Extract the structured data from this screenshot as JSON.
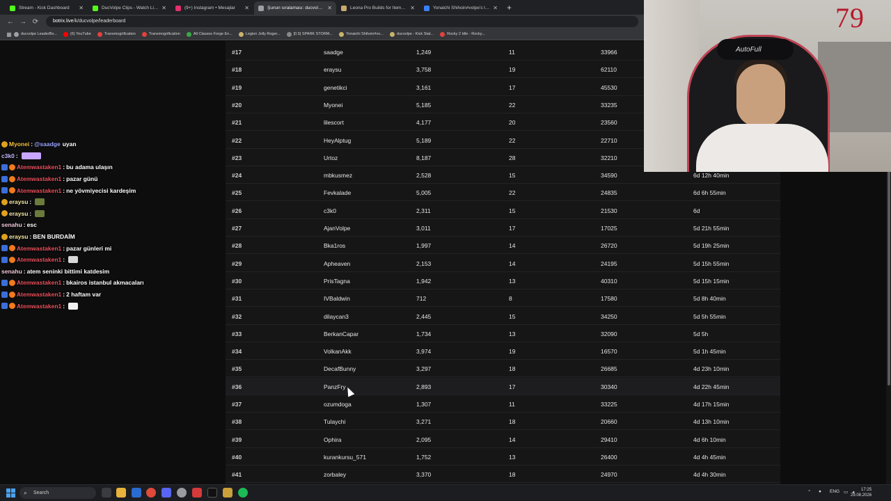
{
  "browser": {
    "tabs": [
      {
        "label": "Stream - Kick Dashboard",
        "color": "#53fc18",
        "active": false
      },
      {
        "label": "DucVolpe Clips - Watch Live on Kick",
        "color": "#53fc18",
        "active": false
      },
      {
        "label": "(9+) Instagram • Mesajlar",
        "color": "#e1306c",
        "active": false
      },
      {
        "label": "Şunun sıralaması: ducvolpe | Yo",
        "color": "#9aa0a6",
        "active": true
      },
      {
        "label": "Leona Pro Builds for Items, Run",
        "color": "#c8aa6e",
        "active": false
      },
      {
        "label": "Yonaichi Shihoin#volpe's live ga",
        "color": "#3b82f6",
        "active": false
      }
    ],
    "new_tab": "+",
    "url_host": "botrix.live",
    "url_path": "/k/ducvolpe/leaderboard",
    "bookmarks": [
      {
        "label": "ducvolpe LeaderBo...",
        "color": "#9aa0a6"
      },
      {
        "label": "(6) YouTube",
        "color": "#ff0000"
      },
      {
        "label": "Transmogrification",
        "color": "#e0433c"
      },
      {
        "label": "Transmogrification",
        "color": "#e0433c"
      },
      {
        "label": "All Classes Forge En...",
        "color": "#39a845"
      },
      {
        "label": "Legion Jolly Roger...",
        "color": "#c8b36a"
      },
      {
        "label": "[0.5] SPARK STORM...",
        "color": "#888888"
      },
      {
        "label": "Yonaichi Shihoin#vo...",
        "color": "#c8b36a"
      },
      {
        "label": "ducvolpe - Kick Stat...",
        "color": "#c8b36a"
      },
      {
        "label": "Rocky 2 Idle - Rocky...",
        "color": "#e0433c"
      }
    ]
  },
  "leaderboard": {
    "rows": [
      {
        "rank": "#17",
        "name": "saadge",
        "v1": "1,249",
        "v2": "11",
        "v3": "33966",
        "time": ""
      },
      {
        "rank": "#18",
        "name": "eraysu",
        "v1": "3,758",
        "v2": "19",
        "v3": "62110",
        "time": ""
      },
      {
        "rank": "#19",
        "name": "genetikci",
        "v1": "3,161",
        "v2": "17",
        "v3": "45530",
        "time": ""
      },
      {
        "rank": "#20",
        "name": "Myonei",
        "v1": "5,185",
        "v2": "22",
        "v3": "33235",
        "time": ""
      },
      {
        "rank": "#21",
        "name": "lilescort",
        "v1": "4,177",
        "v2": "20",
        "v3": "23560",
        "time": ""
      },
      {
        "rank": "#22",
        "name": "HeyAlptug",
        "v1": "5,189",
        "v2": "22",
        "v3": "22710",
        "time": ""
      },
      {
        "rank": "#23",
        "name": "Urtoz",
        "v1": "8,187",
        "v2": "28",
        "v3": "32210",
        "time": ""
      },
      {
        "rank": "#24",
        "name": "mbkusmez",
        "v1": "2,528",
        "v2": "15",
        "v3": "34590",
        "time": "6d 12h 40min"
      },
      {
        "rank": "#25",
        "name": "Fevkalade",
        "v1": "5,005",
        "v2": "22",
        "v3": "24835",
        "time": "6d 6h 55min"
      },
      {
        "rank": "#26",
        "name": "c3k0",
        "v1": "2,311",
        "v2": "15",
        "v3": "21530",
        "time": "6d"
      },
      {
        "rank": "#27",
        "name": "AjanVolpe",
        "v1": "3,011",
        "v2": "17",
        "v3": "17025",
        "time": "5d 21h 55min"
      },
      {
        "rank": "#28",
        "name": "Bka1ros",
        "v1": "1,997",
        "v2": "14",
        "v3": "26720",
        "time": "5d 19h 25min"
      },
      {
        "rank": "#29",
        "name": "Apheaven",
        "v1": "2,153",
        "v2": "14",
        "v3": "24195",
        "time": "5d 15h 55min"
      },
      {
        "rank": "#30",
        "name": "PrisTagna",
        "v1": "1,942",
        "v2": "13",
        "v3": "40310",
        "time": "5d 15h 15min"
      },
      {
        "rank": "#31",
        "name": "IVBaldwin",
        "v1": "712",
        "v2": "8",
        "v3": "17580",
        "time": "5d 8h 40min"
      },
      {
        "rank": "#32",
        "name": "dilaycan3",
        "v1": "2,445",
        "v2": "15",
        "v3": "34250",
        "time": "5d 5h 55min"
      },
      {
        "rank": "#33",
        "name": "BerkanCapar",
        "v1": "1,734",
        "v2": "13",
        "v3": "32090",
        "time": "5d 5h"
      },
      {
        "rank": "#34",
        "name": "VolkanAkk",
        "v1": "3,974",
        "v2": "19",
        "v3": "16570",
        "time": "5d 1h 45min"
      },
      {
        "rank": "#35",
        "name": "DecafBunny",
        "v1": "3,297",
        "v2": "18",
        "v3": "26685",
        "time": "4d 23h 10min"
      },
      {
        "rank": "#36",
        "name": "PanzFry",
        "v1": "2,893",
        "v2": "17",
        "v3": "30340",
        "time": "4d 22h 45min"
      },
      {
        "rank": "#37",
        "name": "ozumdoga",
        "v1": "1,307",
        "v2": "11",
        "v3": "33225",
        "time": "4d 17h 15min"
      },
      {
        "rank": "#38",
        "name": "Tulaychi",
        "v1": "3,271",
        "v2": "18",
        "v3": "20660",
        "time": "4d 13h 10min"
      },
      {
        "rank": "#39",
        "name": "Ophira",
        "v1": "2,095",
        "v2": "14",
        "v3": "29410",
        "time": "4d 6h 10min"
      },
      {
        "rank": "#40",
        "name": "kurankursu_571",
        "v1": "1,752",
        "v2": "13",
        "v3": "26400",
        "time": "4d 4h 45min"
      },
      {
        "rank": "#41",
        "name": "zorbaley",
        "v1": "3,370",
        "v2": "18",
        "v3": "24970",
        "time": "4d 4h 30min"
      }
    ]
  },
  "chat": {
    "messages": [
      {
        "badges": [
          "gold"
        ],
        "user": "Myonei",
        "user_color": "#f2c037",
        "mention": "@saadge",
        "text": "uyan",
        "emote": ""
      },
      {
        "badges": [],
        "user": "c3k0",
        "user_color": "#c7b8ff",
        "mention": "",
        "text": "",
        "emote": "#c9a6ff"
      },
      {
        "badges": [
          "blue",
          "fox"
        ],
        "user": "Atemwastaken1",
        "user_color": "#e8505b",
        "mention": "",
        "text": "bu adama ulaşın",
        "emote": ""
      },
      {
        "badges": [
          "blue",
          "fox"
        ],
        "user": "Atemwastaken1",
        "user_color": "#e8505b",
        "mention": "",
        "text": "pazar günü",
        "emote": ""
      },
      {
        "badges": [
          "blue",
          "fox"
        ],
        "user": "Atemwastaken1",
        "user_color": "#e8505b",
        "mention": "",
        "text": "ne yövmiyecisi kardeşim",
        "emote": ""
      },
      {
        "badges": [
          "gold"
        ],
        "user": "eraysu",
        "user_color": "#f2e7a0",
        "mention": "",
        "text": "",
        "emote": "#6b7b3a"
      },
      {
        "badges": [
          "gold"
        ],
        "user": "eraysu",
        "user_color": "#f2e7a0",
        "mention": "",
        "text": "",
        "emote": "#6b7b3a"
      },
      {
        "badges": [],
        "user": "senahu",
        "user_color": "#f0c8d8",
        "mention": "",
        "text": "esc",
        "emote": ""
      },
      {
        "badges": [
          "gold"
        ],
        "user": "eraysu",
        "user_color": "#f2e7a0",
        "mention": "",
        "text": "BEN BURDAİM",
        "emote": ""
      },
      {
        "badges": [
          "blue",
          "fox"
        ],
        "user": "Atemwastaken1",
        "user_color": "#e8505b",
        "mention": "",
        "text": "pazar günleri mi",
        "emote": ""
      },
      {
        "badges": [
          "blue",
          "fox"
        ],
        "user": "Atemwastaken1",
        "user_color": "#e8505b",
        "mention": "",
        "text": "",
        "emote": "#d8d8d8"
      },
      {
        "badges": [],
        "user": "senahu",
        "user_color": "#f0c8d8",
        "mention": "",
        "text": "atem seninki bittimi katdesim",
        "emote": ""
      },
      {
        "badges": [
          "blue",
          "fox"
        ],
        "user": "Atemwastaken1",
        "user_color": "#e8505b",
        "mention": "",
        "text": "bkairos istanbul akmacaları",
        "emote": ""
      },
      {
        "badges": [
          "blue",
          "fox"
        ],
        "user": "Atemwastaken1",
        "user_color": "#e8505b",
        "mention": "",
        "text": "2 haftam var",
        "emote": ""
      },
      {
        "badges": [
          "blue",
          "fox"
        ],
        "user": "Atemwastaken1",
        "user_color": "#e8505b",
        "mention": "",
        "text": "",
        "emote": "#f2f2f2"
      }
    ]
  },
  "webcam": {
    "overlay_counter": "79",
    "chair_logo": "AutoFull"
  },
  "taskbar": {
    "search_label": "Search",
    "language": "ENG",
    "time": "17:25",
    "date": "29.08.2026"
  }
}
